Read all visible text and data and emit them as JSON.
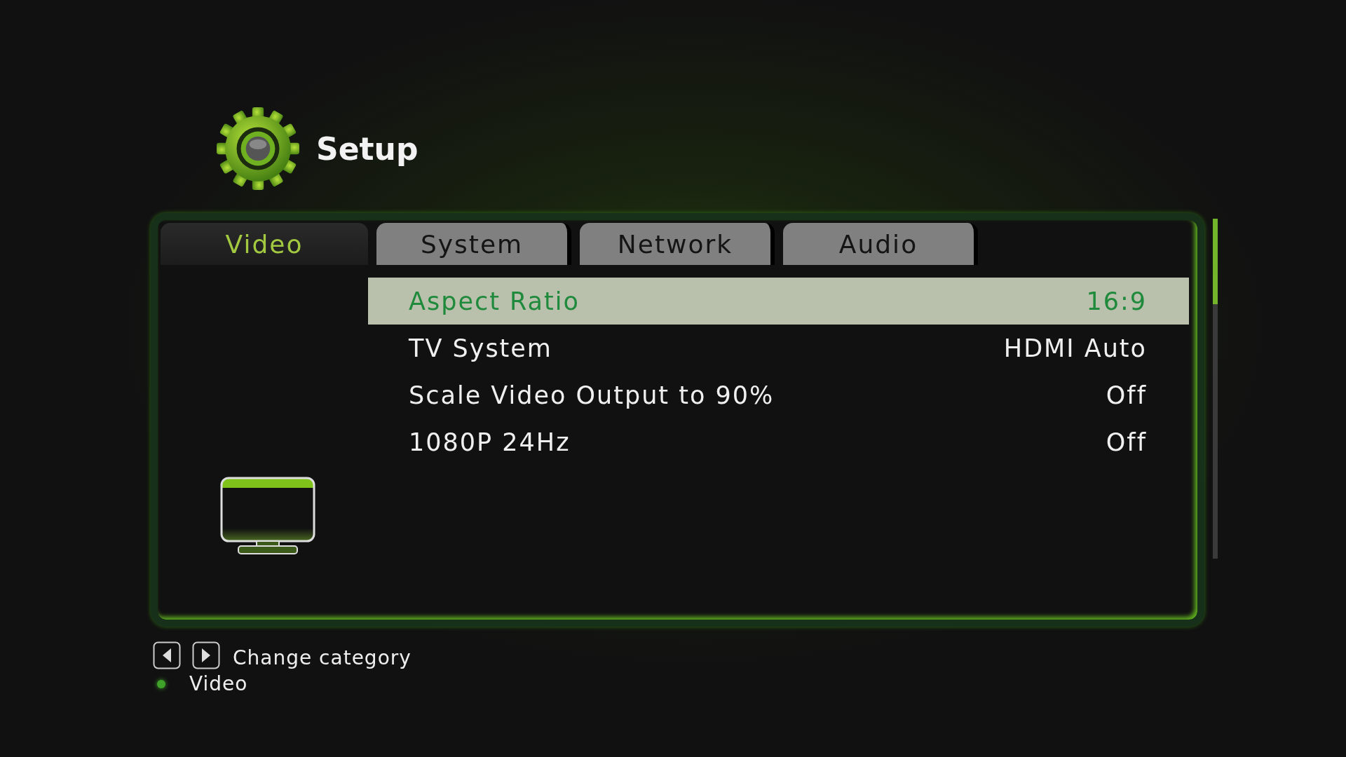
{
  "header": {
    "title": "Setup"
  },
  "tabs": [
    {
      "label": "Video",
      "selected": true
    },
    {
      "label": "System",
      "selected": false
    },
    {
      "label": "Network",
      "selected": false
    },
    {
      "label": "Audio",
      "selected": false
    }
  ],
  "settings": [
    {
      "label": "Aspect Ratio",
      "value": "16:9",
      "selected": true
    },
    {
      "label": "TV System",
      "value": "HDMI Auto",
      "selected": false
    },
    {
      "label": "Scale Video Output to 90%",
      "value": "Off",
      "selected": false
    },
    {
      "label": "1080P 24Hz",
      "value": "Off",
      "selected": false
    }
  ],
  "footer": {
    "hint": "Change category",
    "current": "Video"
  }
}
